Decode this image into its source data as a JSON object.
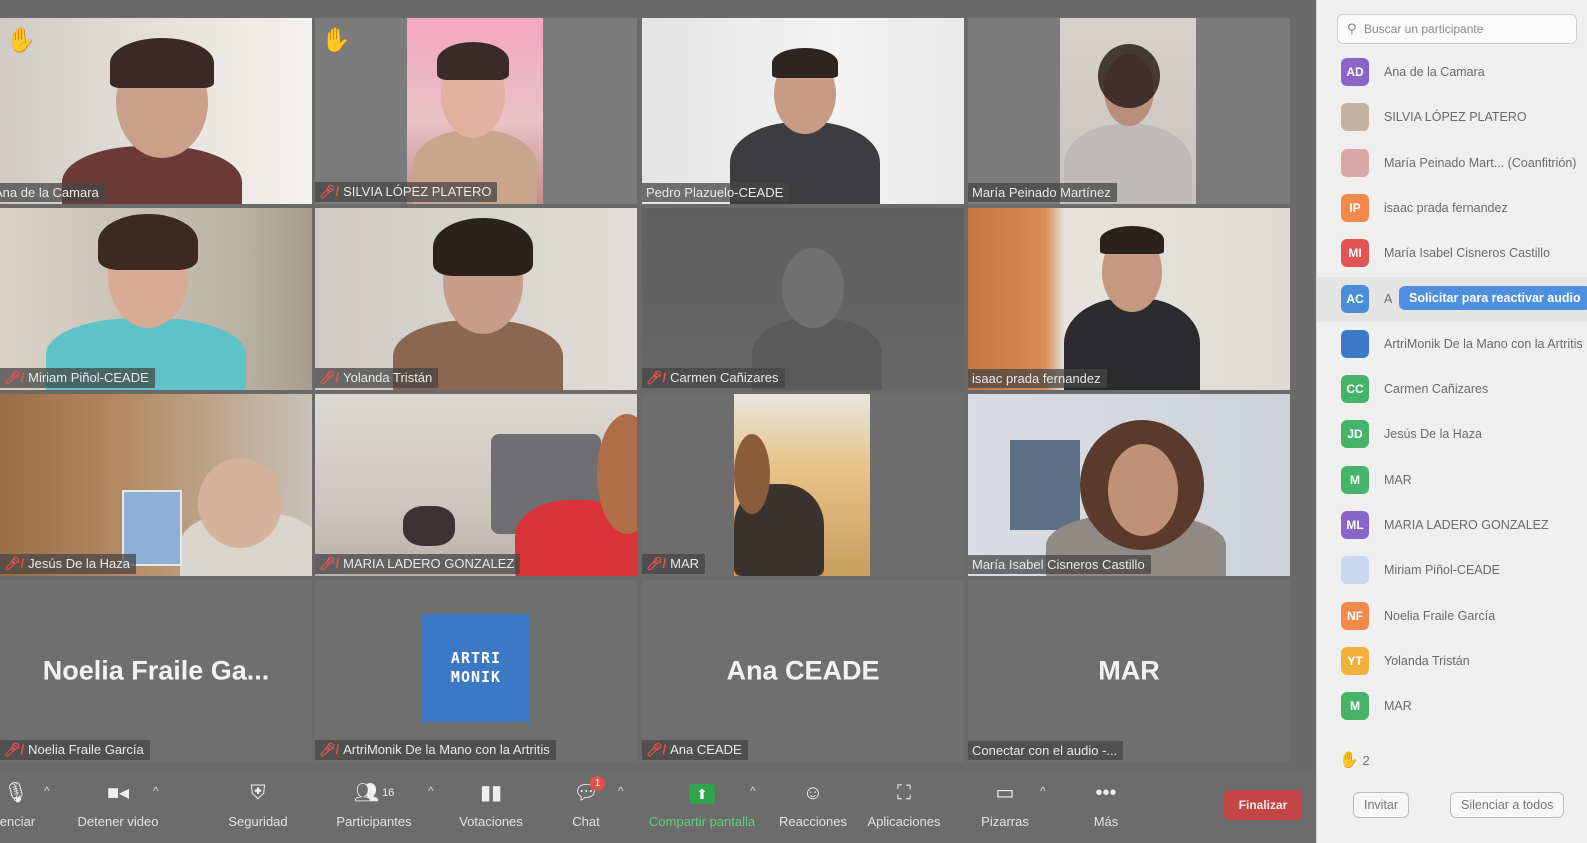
{
  "tiles": [
    {
      "name": "Ana de la Camara",
      "muted": false,
      "hand": true,
      "active": true
    },
    {
      "name": "SILVIA LÓPEZ PLATERO",
      "muted": true,
      "hand": true
    },
    {
      "name": "Pedro Plazuelo-CEADE",
      "muted": false
    },
    {
      "name": "María Peinado Martínez",
      "muted": false
    },
    {
      "name": "Miriam Piñol-CEADE",
      "muted": true
    },
    {
      "name": "Yolanda Tristán",
      "muted": true
    },
    {
      "name": "Carmen Cañizares",
      "muted": true
    },
    {
      "name": "isaac prada fernandez",
      "muted": false
    },
    {
      "name": "Jesús De la Haza",
      "muted": true
    },
    {
      "name": "MARIA LADERO GONZALEZ",
      "muted": true
    },
    {
      "name": "MAR",
      "muted": true
    },
    {
      "name": "María Isabel Cisneros Castillo",
      "muted": false
    },
    {
      "name": "Noelia Fraile García",
      "muted": true,
      "display": "Noelia  Fraile  Ga..."
    },
    {
      "name": "ArtriMonik De la Mano con la Artritis",
      "muted": true,
      "logo": "ARTRI MONIK"
    },
    {
      "name": "Ana CEADE",
      "muted": true,
      "display": "Ana CEADE"
    },
    {
      "name": "Conectar con el audio -...",
      "muted": false,
      "display": "MAR"
    }
  ],
  "toolbar": {
    "mute": "lenciar",
    "video": "Detener video",
    "security": "Seguridad",
    "participants": "Participantes",
    "participants_count": "16",
    "polls": "Votaciones",
    "chat": "Chat",
    "chat_badge": "1",
    "share": "Compartir pantalla",
    "reactions": "Reacciones",
    "apps": "Aplicaciones",
    "whiteboards": "Pizarras",
    "more": "Más",
    "end": "Finalizar"
  },
  "panel": {
    "search_placeholder": "Buscar un participante",
    "participants": [
      {
        "initials": "AD",
        "name": "Ana de la Camara",
        "color": "#8a64c9"
      },
      {
        "initials": "",
        "name": "SILVIA LÓPEZ PLATERO",
        "color": "#c5b1a0",
        "photo": true
      },
      {
        "initials": "",
        "name": "María Peinado Mart... (Coanfitrión)",
        "color": "#d8a8a8",
        "photo": true
      },
      {
        "initials": "IP",
        "name": "isaac prada fernandez",
        "color": "#f0894a"
      },
      {
        "initials": "MI",
        "name": "María Isabel Cisneros Castillo",
        "color": "#e25454"
      },
      {
        "initials": "AC",
        "name": "A",
        "color": "#4a8fd6",
        "tooltip": "Solicitar para reactivar audio"
      },
      {
        "initials": "",
        "name": "ArtriMonik De la Mano con la Artritis",
        "color": "#3b79c4",
        "photo": true
      },
      {
        "initials": "CC",
        "name": "Carmen Cañizares",
        "color": "#46b36b"
      },
      {
        "initials": "JD",
        "name": "Jesús De la Haza",
        "color": "#46b36b"
      },
      {
        "initials": "M",
        "name": "MAR",
        "color": "#46b36b"
      },
      {
        "initials": "ML",
        "name": "MARIA LADERO GONZALEZ",
        "color": "#8a64c9"
      },
      {
        "initials": "",
        "name": "Miriam Piñol-CEADE",
        "color": "#c9d8ee",
        "photo": true
      },
      {
        "initials": "NF",
        "name": "Noelia Fraile García",
        "color": "#f0894a"
      },
      {
        "initials": "YT",
        "name": "Yolanda Tristán",
        "color": "#f3b13b"
      },
      {
        "initials": "M",
        "name": "MAR",
        "color": "#46b36b"
      }
    ],
    "raised_hands": "2",
    "invite": "Invitar",
    "mute_all": "Silenciar a todos"
  }
}
